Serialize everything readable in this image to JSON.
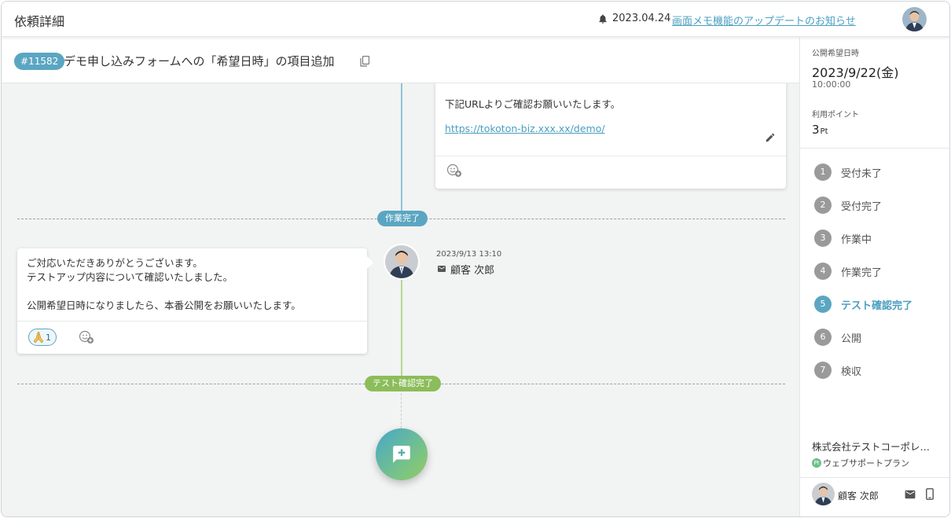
{
  "app": {
    "title": "依頼詳細"
  },
  "notice": {
    "date": "2023.04.24",
    "link": "画面メモ機能のアップデートのお知らせ"
  },
  "request": {
    "id": "#11582",
    "title": "デモ申し込みフォームへの「希望日時」の項目追加"
  },
  "timeline": {
    "card1": {
      "text": "下記URLよりご確認お願いいたします。",
      "link": "https://tokoton-biz.xxx.xx/demo/"
    },
    "status_done": "作業完了",
    "comment": {
      "lines": [
        "ご対応いただきありがとうございます。",
        "テストアップ内容について確認いたしました。",
        "",
        "公開希望日時になりましたら、本番公開をお願いいたします。"
      ],
      "reaction_count": "1",
      "time": "2023/9/13 13:10",
      "author": "顧客 次郎"
    },
    "status_test": "テスト確認完了"
  },
  "sidebar": {
    "publish_label": "公開希望日時",
    "publish_date": "2023/9/22(金)",
    "publish_time": "10:00:00",
    "points_label": "利用ポイント",
    "points_value": "3",
    "points_unit": "Pt",
    "steps": [
      {
        "num": "1",
        "label": "受付未了"
      },
      {
        "num": "2",
        "label": "受付完了"
      },
      {
        "num": "3",
        "label": "作業中"
      },
      {
        "num": "4",
        "label": "作業完了"
      },
      {
        "num": "5",
        "label": "テスト確認完了"
      },
      {
        "num": "6",
        "label": "公開"
      },
      {
        "num": "7",
        "label": "検収"
      }
    ],
    "active_step": 5,
    "company": "株式会社テストコーポレ…",
    "plan_badge": "Pt",
    "plan": "ウェブサポートプラン",
    "user_name": "顧客 次郎"
  },
  "colors": {
    "accent": "#5aa6c2",
    "link": "#4a9fc0",
    "test_green": "#8bbd5a",
    "step_inactive": "#9a9a9a"
  },
  "icons": {
    "bell": "bell-icon",
    "copy": "copy-icon",
    "pencil": "pencil-icon",
    "emoji_add": "emoji-add-icon",
    "pray": "pray-icon",
    "mail": "mail-icon",
    "phone": "phone-icon",
    "add_comment": "add-comment-icon"
  }
}
